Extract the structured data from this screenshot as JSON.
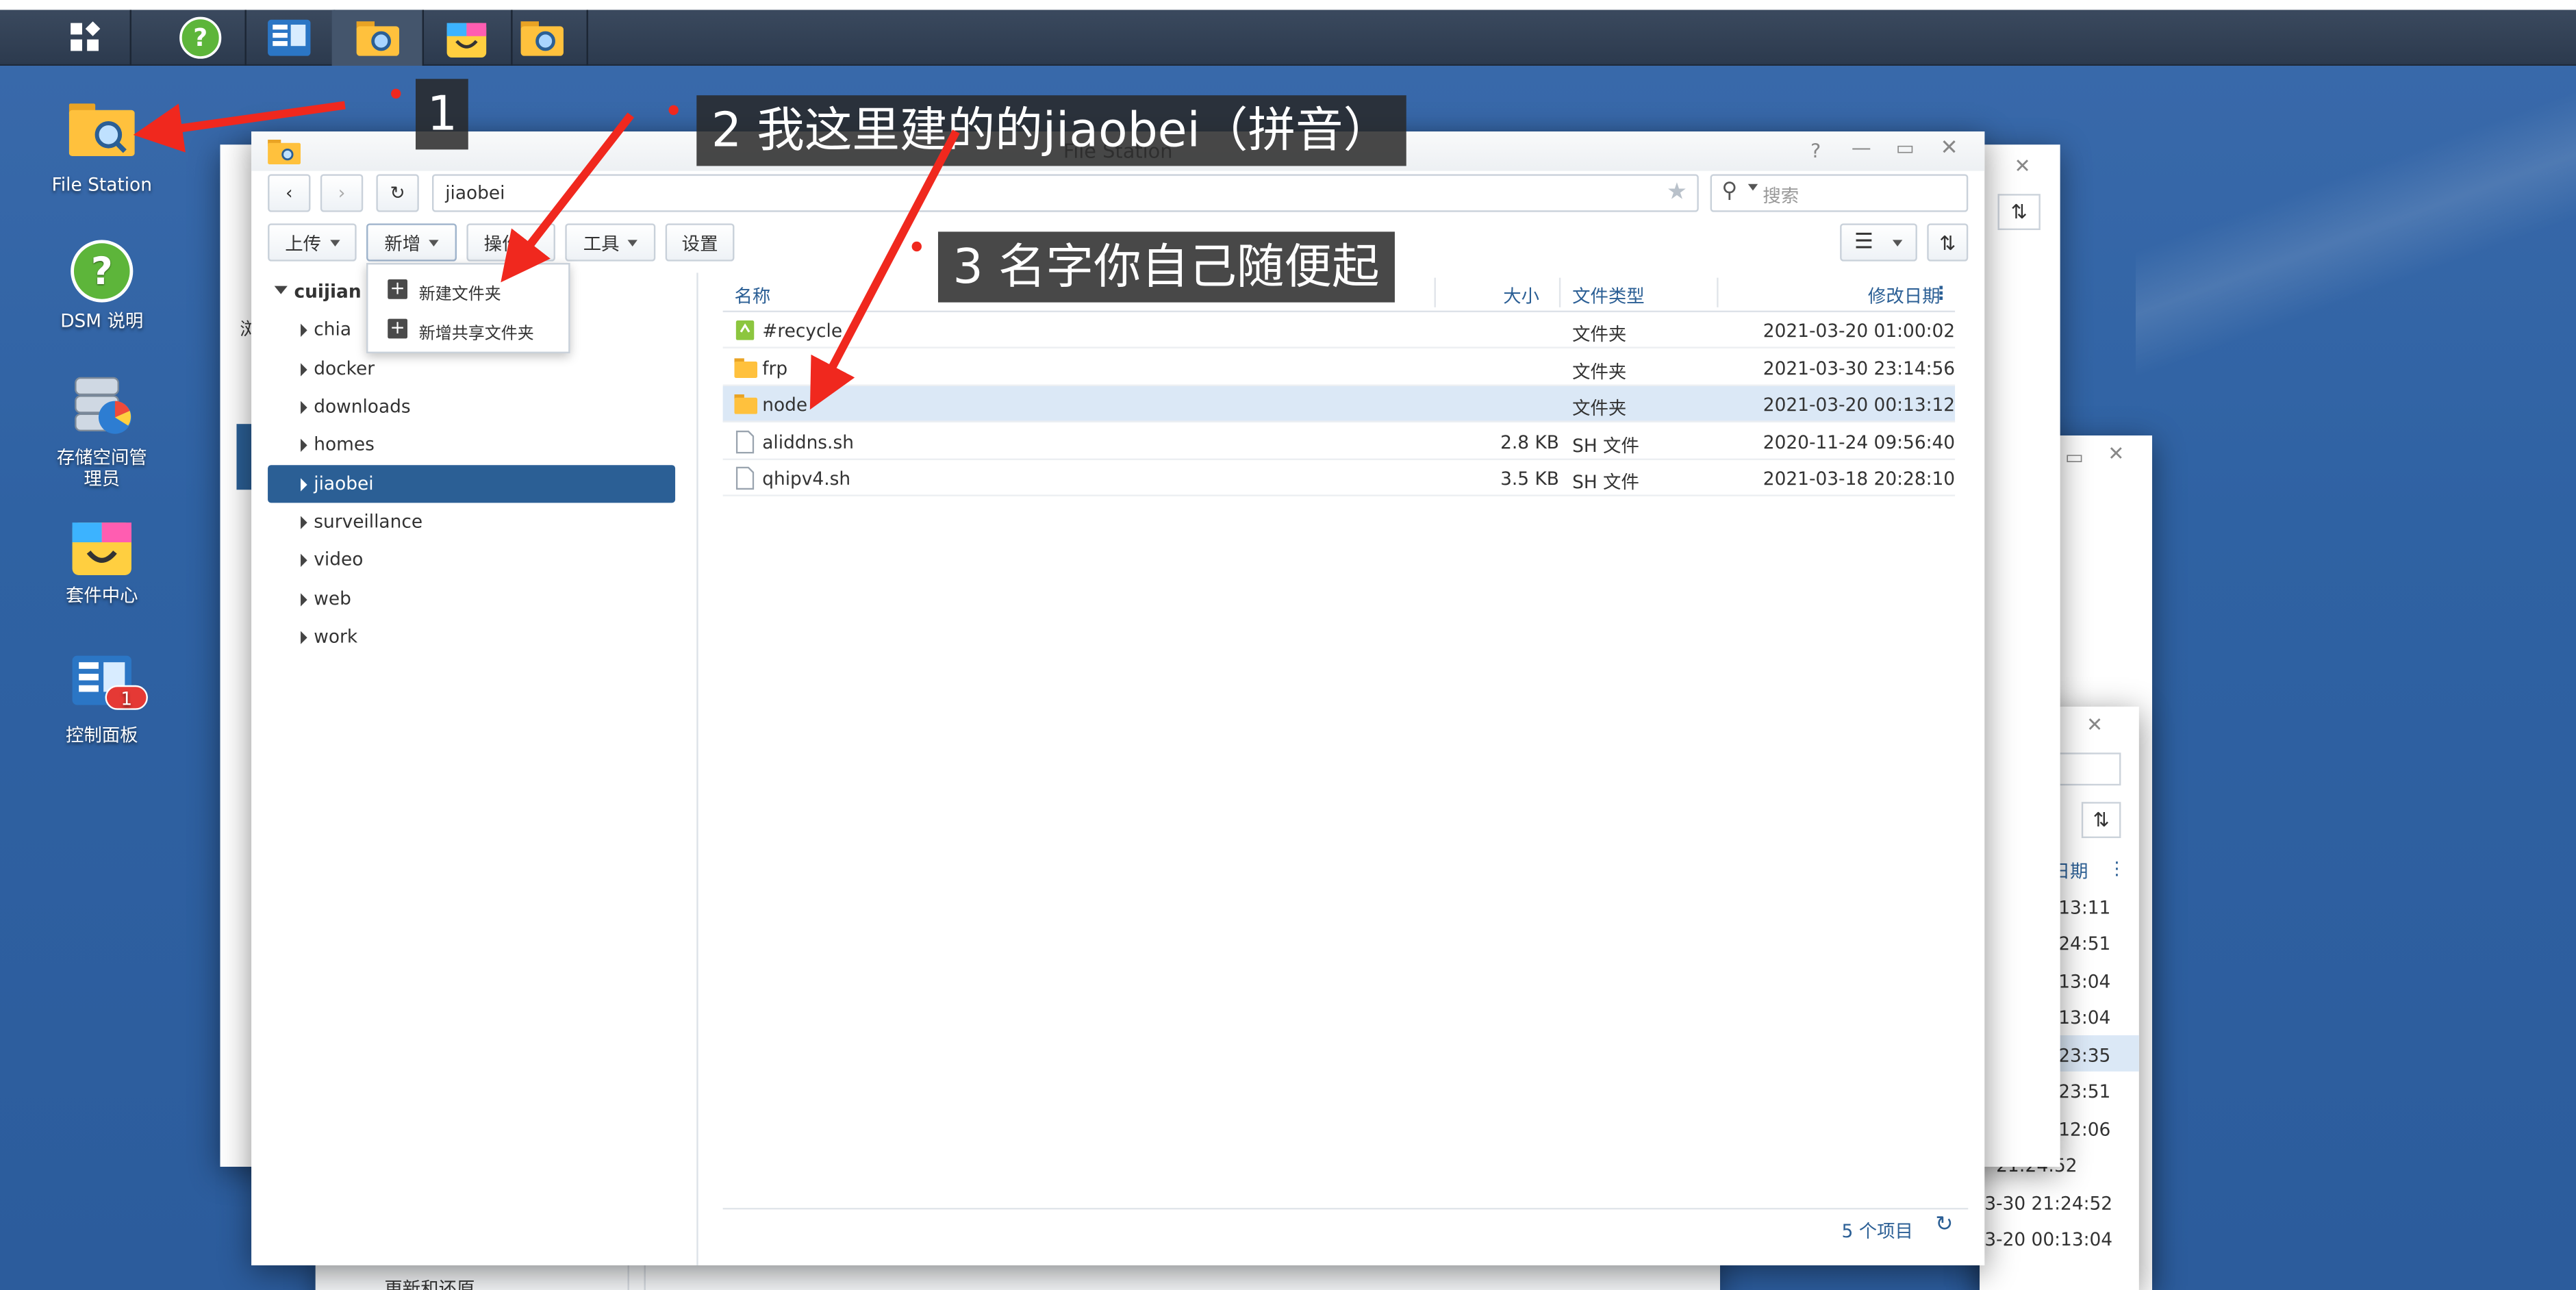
{
  "desktop": {
    "icons": [
      {
        "label": "File Station",
        "icon": "file-station-folder"
      },
      {
        "label": "DSM 说明",
        "icon": "help-question-mark"
      },
      {
        "label": "存储空间管理员",
        "icon": "storage-manager"
      },
      {
        "label": "套件中心",
        "icon": "package-center-bag"
      },
      {
        "label": "控制面板",
        "icon": "control-panel",
        "badge": "1"
      }
    ]
  },
  "taskbar": {
    "items": [
      "main-menu-icon",
      "help-icon",
      "control-panel-icon",
      "file-station-icon",
      "package-center-icon",
      "file-station-icon"
    ]
  },
  "file_station": {
    "title": "File Station",
    "path_value": "jiaobei",
    "search_placeholder": "搜索",
    "toolbar": {
      "upload": "上传",
      "create": "新增",
      "action": "操作",
      "tools": "工具",
      "settings": "设置"
    },
    "create_menu": {
      "new_folder": "新建文件夹",
      "new_shared_folder": "新增共享文件夹"
    },
    "tree": {
      "root": "cuijian",
      "items": [
        "chia",
        "docker",
        "downloads",
        "homes",
        "jiaobei",
        "surveillance",
        "video",
        "web",
        "work"
      ],
      "selected": "jiaobei"
    },
    "columns": {
      "name": "名称",
      "size": "大小",
      "type": "文件类型",
      "modified": "修改日期"
    },
    "files": [
      {
        "name": "#recycle",
        "size": "",
        "type": "文件夹",
        "modified": "2021-03-20 01:00:02",
        "icon": "recycle-folder"
      },
      {
        "name": "frp",
        "size": "",
        "type": "文件夹",
        "modified": "2021-03-30 23:14:56",
        "icon": "folder"
      },
      {
        "name": "node",
        "size": "",
        "type": "文件夹",
        "modified": "2021-03-20 00:13:12",
        "icon": "folder"
      },
      {
        "name": "aliddns.sh",
        "size": "2.8 KB",
        "type": "SH 文件",
        "modified": "2020-11-24 09:56:40",
        "icon": "file"
      },
      {
        "name": "qhipv4.sh",
        "size": "3.5 KB",
        "type": "SH 文件",
        "modified": "2021-03-18 20:28:10",
        "icon": "file"
      }
    ],
    "status": {
      "count": "5 个项目"
    }
  },
  "annotations": {
    "callout_1": "1",
    "callout_2": "2 我这里建的的jiaobei（拼音）",
    "callout_3": "3 名字你自己随便起"
  },
  "background_window": {
    "times": [
      "13:11",
      "24:51",
      "13:04",
      "13:04",
      "23:35",
      "23:51",
      "12:06",
      "21:24:52",
      "3-30 21:24:52",
      "3-20 00:13:04"
    ],
    "col_suffix": "日期",
    "bottom_label": "更新和还原",
    "left_fragment": "浏"
  },
  "colors": {
    "desktop": "#2f62a3",
    "selection": "#2b5f95",
    "arrow": "#f0281e"
  }
}
